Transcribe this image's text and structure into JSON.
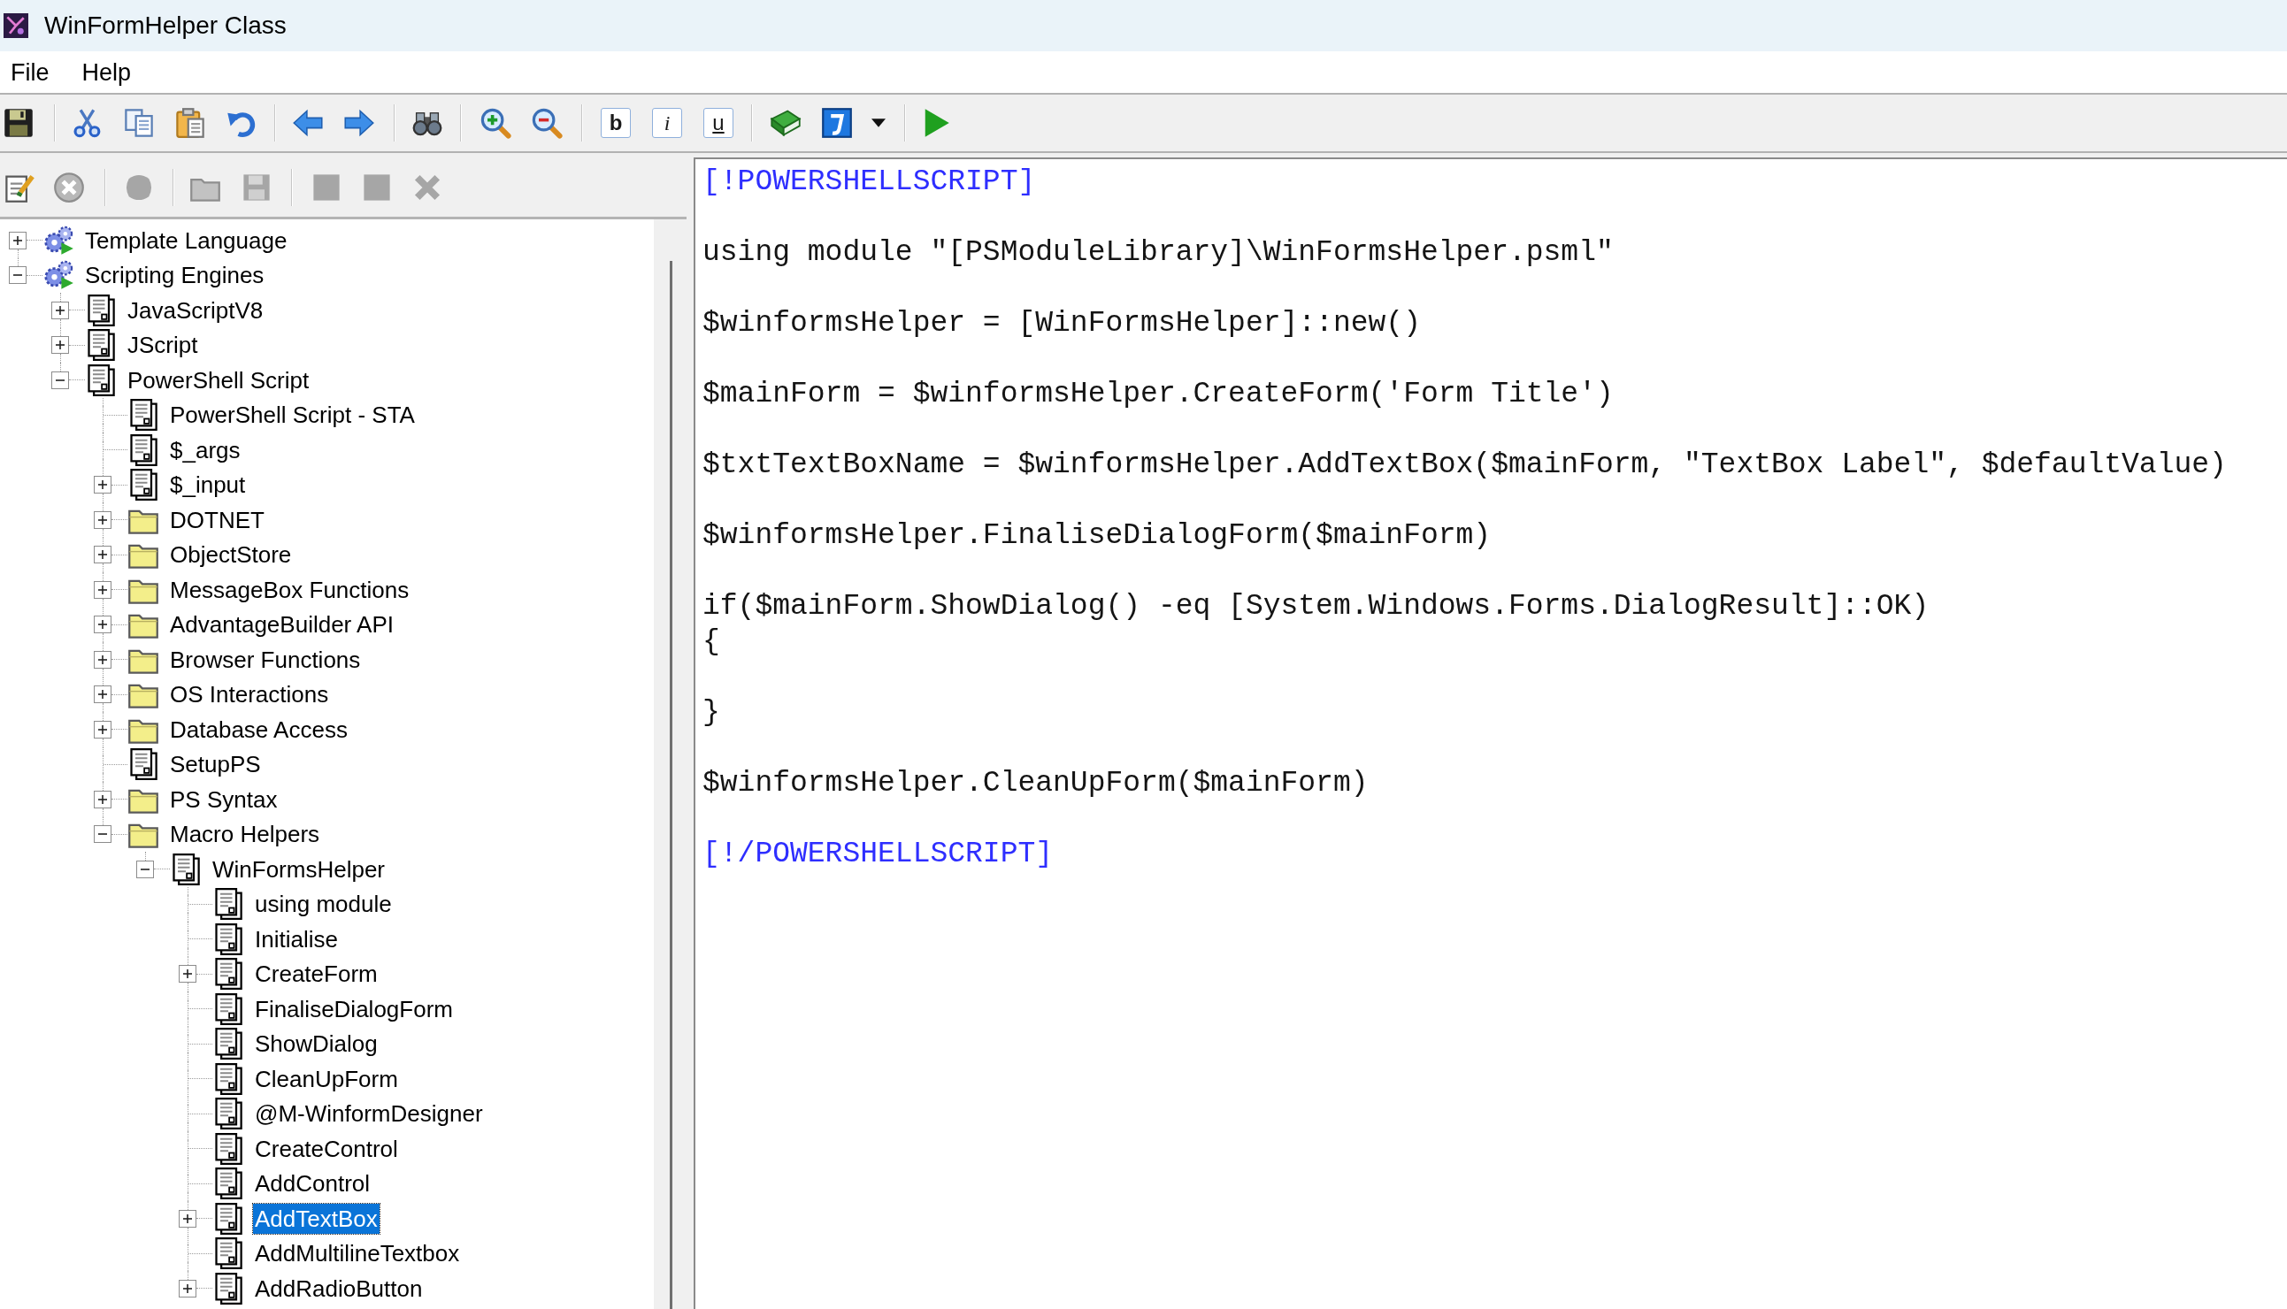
{
  "window": {
    "title": "WinFormHelper Class"
  },
  "menu": [
    {
      "label": "File"
    },
    {
      "label": "Help"
    }
  ],
  "toolbar": {
    "format_buttons": [
      {
        "kind": "bold",
        "label": "b"
      },
      {
        "kind": "italic",
        "label": "i"
      },
      {
        "kind": "underline",
        "label": "u"
      }
    ]
  },
  "tree_toolbar": {
    "buttons": [
      {
        "disabled": false
      },
      {
        "disabled": true
      },
      {
        "disabled": true
      },
      {
        "disabled": true
      },
      {
        "disabled": true
      },
      {
        "disabled": true
      },
      {
        "disabled": true
      },
      {
        "disabled": true
      }
    ]
  },
  "tree": [
    {
      "label": "Template Language",
      "kind": "engine",
      "expanded": false,
      "selected": false
    },
    {
      "label": "Scripting Engines",
      "kind": "engine",
      "expanded": true,
      "selected": false,
      "children": [
        {
          "label": "JavaScriptV8",
          "kind": "script",
          "expanded": false,
          "selected": false
        },
        {
          "label": "JScript",
          "kind": "script",
          "expanded": false,
          "selected": false
        },
        {
          "label": "PowerShell Script",
          "kind": "script",
          "expanded": true,
          "selected": false,
          "children": [
            {
              "label": "PowerShell Script - STA",
              "kind": "script",
              "selected": false
            },
            {
              "label": "$_args",
              "kind": "script",
              "selected": false
            },
            {
              "label": "$_input",
              "kind": "script",
              "expanded": false,
              "selected": false
            },
            {
              "label": "DOTNET",
              "kind": "folder",
              "expanded": false,
              "selected": false
            },
            {
              "label": "ObjectStore",
              "kind": "folder",
              "expanded": false,
              "selected": false
            },
            {
              "label": "MessageBox Functions",
              "kind": "folder",
              "expanded": false,
              "selected": false
            },
            {
              "label": "AdvantageBuilder API",
              "kind": "folder",
              "expanded": false,
              "selected": false
            },
            {
              "label": "Browser Functions",
              "kind": "folder",
              "expanded": false,
              "selected": false
            },
            {
              "label": "OS Interactions",
              "kind": "folder",
              "expanded": false,
              "selected": false
            },
            {
              "label": "Database Access",
              "kind": "folder",
              "expanded": false,
              "selected": false
            },
            {
              "label": "SetupPS",
              "kind": "script",
              "selected": false
            },
            {
              "label": "PS Syntax",
              "kind": "folder",
              "expanded": false,
              "selected": false
            },
            {
              "label": "Macro Helpers",
              "kind": "folder",
              "expanded": true,
              "selected": false,
              "children": [
                {
                  "label": "WinFormsHelper",
                  "kind": "script",
                  "expanded": true,
                  "selected": false,
                  "children": [
                    {
                      "label": "using module",
                      "kind": "script",
                      "selected": false
                    },
                    {
                      "label": "Initialise",
                      "kind": "script",
                      "selected": false
                    },
                    {
                      "label": "CreateForm",
                      "kind": "script",
                      "expanded": false,
                      "selected": false
                    },
                    {
                      "label": "FinaliseDialogForm",
                      "kind": "script",
                      "selected": false
                    },
                    {
                      "label": "ShowDialog",
                      "kind": "script",
                      "selected": false
                    },
                    {
                      "label": "CleanUpForm",
                      "kind": "script",
                      "selected": false
                    },
                    {
                      "label": "@M-WinformDesigner",
                      "kind": "script",
                      "selected": false
                    },
                    {
                      "label": "CreateControl",
                      "kind": "script",
                      "selected": false
                    },
                    {
                      "label": "AddControl",
                      "kind": "script",
                      "selected": false
                    },
                    {
                      "label": "AddTextBox",
                      "kind": "script",
                      "expanded": false,
                      "selected": true
                    },
                    {
                      "label": "AddMultilineTextbox",
                      "kind": "script",
                      "selected": false
                    },
                    {
                      "label": "AddRadioButton",
                      "kind": "script",
                      "expanded": false,
                      "selected": false
                    }
                  ]
                }
              ]
            }
          ]
        }
      ]
    }
  ],
  "editor": {
    "blocks": [
      {
        "kind": "tag",
        "lines": [
          "[!POWERSHELLSCRIPT]"
        ]
      },
      {
        "kind": "code",
        "lines": [
          "using module \"[PSModuleLibrary]\\WinFormsHelper.psml\""
        ]
      },
      {
        "kind": "code",
        "lines": [
          "$winformsHelper = [WinFormsHelper]::new()"
        ]
      },
      {
        "kind": "code",
        "lines": [
          "$mainForm = $winformsHelper.CreateForm('Form Title')"
        ]
      },
      {
        "kind": "code",
        "lines": [
          "$txtTextBoxName = $winformsHelper.AddTextBox($mainForm, \"TextBox Label\", $defaultValue)"
        ]
      },
      {
        "kind": "code",
        "lines": [
          "$winformsHelper.FinaliseDialogForm($mainForm)"
        ]
      },
      {
        "kind": "code",
        "lines": [
          "if($mainForm.ShowDialog() -eq [System.Windows.Forms.DialogResult]::OK)",
          "{"
        ]
      },
      {
        "kind": "code",
        "lines": [
          "}"
        ]
      },
      {
        "kind": "code",
        "lines": [
          "$winformsHelper.CleanUpForm($mainForm)"
        ]
      },
      {
        "kind": "tag",
        "lines": [
          "[!/POWERSHELLSCRIPT]"
        ]
      }
    ]
  }
}
